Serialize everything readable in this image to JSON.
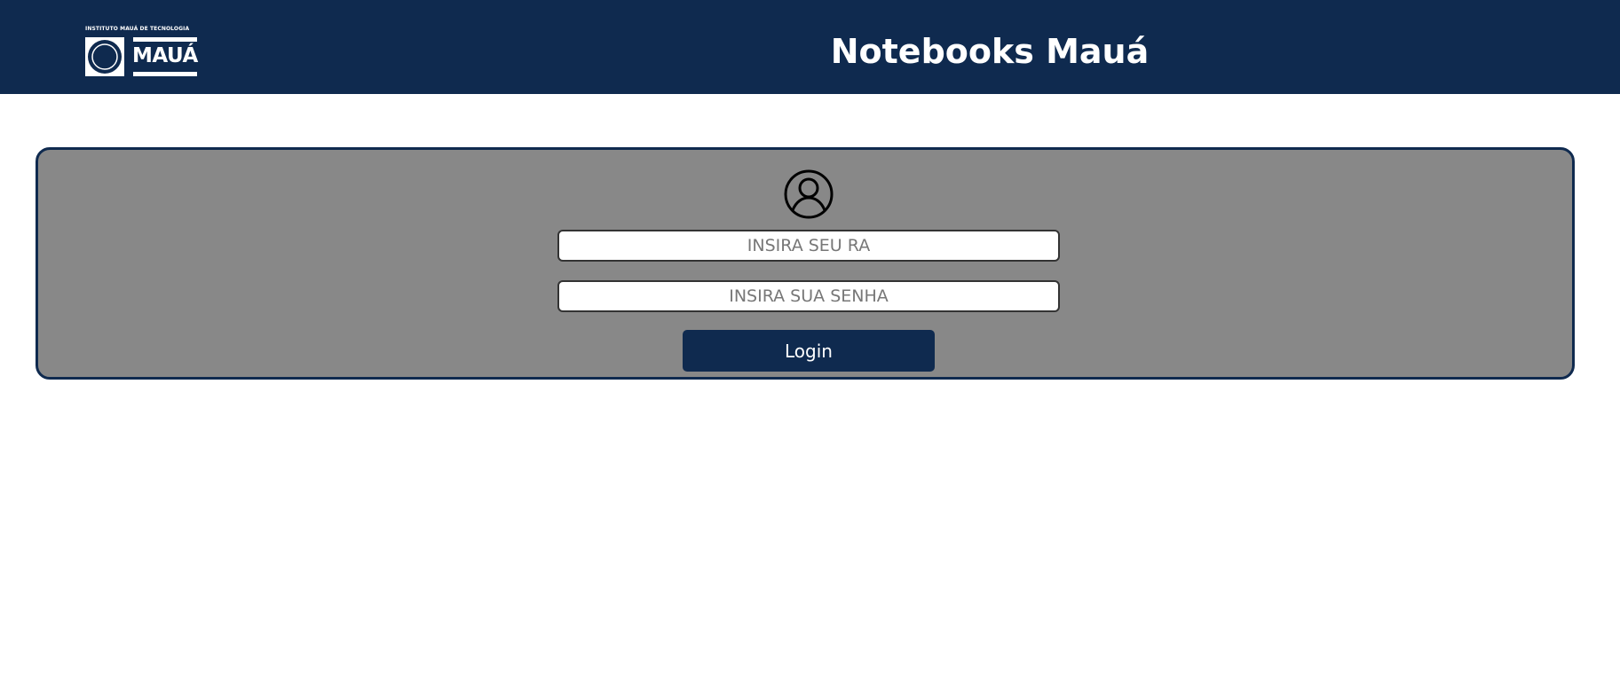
{
  "header": {
    "logo": {
      "caption": "INSTITUTO MAUÁ DE TECNOLOGIA",
      "wordmark": "MAUÁ"
    },
    "title": "Notebooks Mauá"
  },
  "login": {
    "ra_placeholder": "INSIRA SEU RA",
    "password_placeholder": "INSIRA SUA SENHA",
    "submit_label": "Login",
    "icon": "user-circle-icon"
  },
  "colors": {
    "brand_navy": "#0f2a4f",
    "card_background": "#888888",
    "page_background": "#ffffff"
  }
}
